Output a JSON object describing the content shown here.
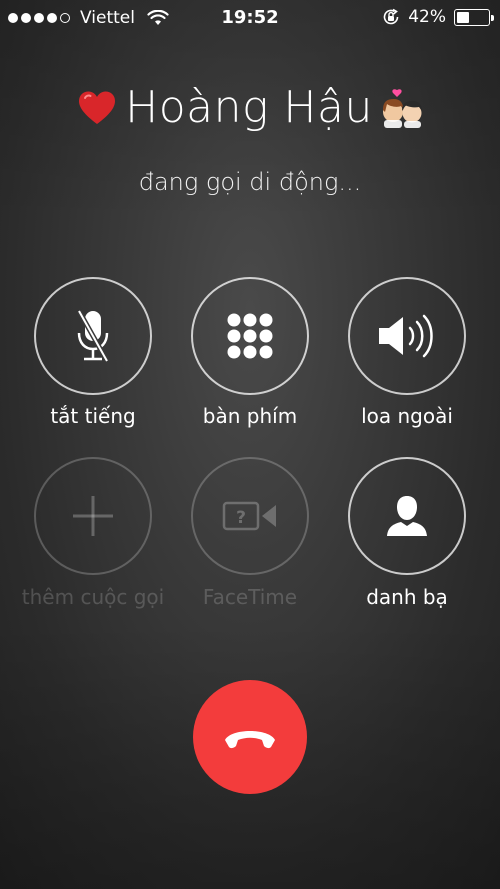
{
  "status_bar": {
    "carrier": "Viettel",
    "signal_bars_filled": 4,
    "signal_bars_total": 5,
    "time": "19:52",
    "battery_text": "42%",
    "battery_level": 0.42
  },
  "caller": {
    "name": "Hoàng Hậu",
    "status": "đang gọi di động..."
  },
  "buttons": {
    "mute": {
      "label": "tắt tiếng",
      "icon": "mic-off-icon"
    },
    "keypad": {
      "label": "bàn phím",
      "icon": "keypad-icon"
    },
    "speaker": {
      "label": "loa ngoài",
      "icon": "speaker-icon"
    },
    "add_call": {
      "label": "thêm cuộc gọi",
      "icon": "plus-icon"
    },
    "facetime": {
      "label": "FaceTime",
      "icon": "facetime-icon"
    },
    "contacts": {
      "label": "danh bạ",
      "icon": "contact-icon"
    }
  },
  "end_call": {
    "icon": "end-call-icon",
    "color": "#f33c3c"
  }
}
